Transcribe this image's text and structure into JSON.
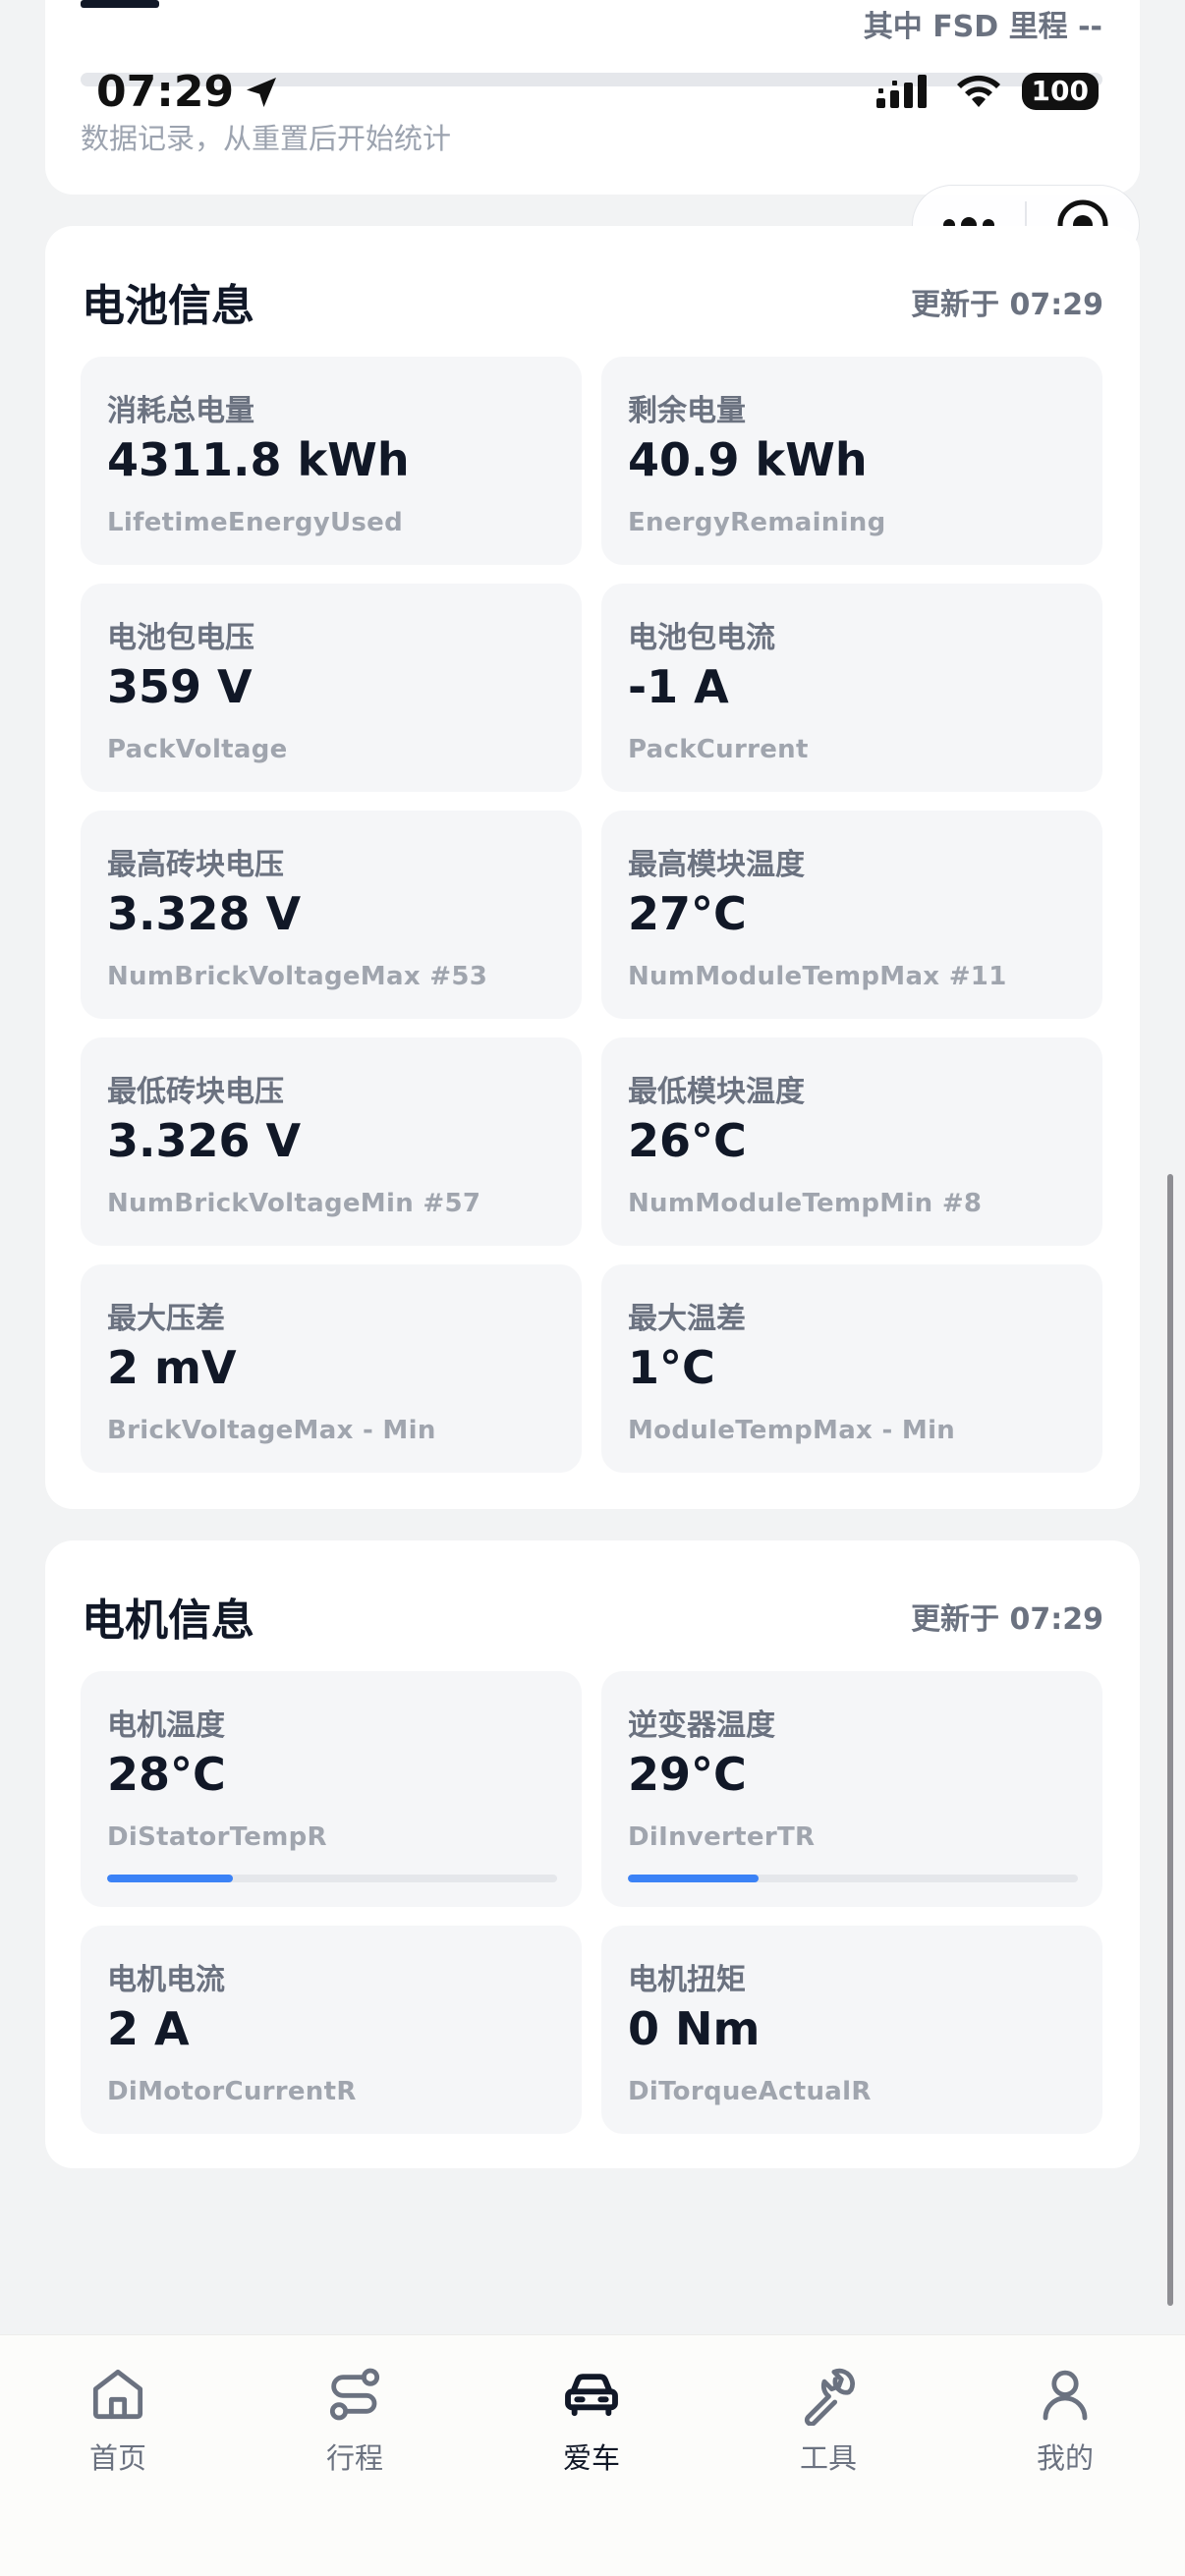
{
  "status_bar": {
    "time": "07:29",
    "battery": "100"
  },
  "top_card": {
    "fsd_label": "其中 FSD 里程 --",
    "note": "数据记录，从重置后开始统计"
  },
  "battery_section": {
    "title": "电池信息",
    "updated": "更新于 07:29",
    "tiles": [
      {
        "label": "消耗总电量",
        "value": "4311.8 kWh",
        "sub": "LifetimeEnergyUsed"
      },
      {
        "label": "剩余电量",
        "value": "40.9 kWh",
        "sub": "EnergyRemaining"
      },
      {
        "label": "电池包电压",
        "value": "359 V",
        "sub": "PackVoltage"
      },
      {
        "label": "电池包电流",
        "value": "-1 A",
        "sub": "PackCurrent"
      },
      {
        "label": "最高砖块电压",
        "value": "3.328 V",
        "sub": "NumBrickVoltageMax #53"
      },
      {
        "label": "最高模块温度",
        "value": "27°C",
        "sub": "NumModuleTempMax #11"
      },
      {
        "label": "最低砖块电压",
        "value": "3.326 V",
        "sub": "NumBrickVoltageMin #57"
      },
      {
        "label": "最低模块温度",
        "value": "26°C",
        "sub": "NumModuleTempMin #8"
      },
      {
        "label": "最大压差",
        "value": "2 mV",
        "sub": "BrickVoltageMax - Min"
      },
      {
        "label": "最大温差",
        "value": "1°C",
        "sub": "ModuleTempMax - Min"
      }
    ]
  },
  "motor_section": {
    "title": "电机信息",
    "updated": "更新于 07:29",
    "tiles": [
      {
        "label": "电机温度",
        "value": "28°C",
        "sub": "DiStatorTempR",
        "level_fraction": 0.28
      },
      {
        "label": "逆变器温度",
        "value": "29°C",
        "sub": "DiInverterTR",
        "level_fraction": 0.29
      },
      {
        "label": "电机电流",
        "value": "2 A",
        "sub": "DiMotorCurrentR"
      },
      {
        "label": "电机扭矩",
        "value": "0 Nm",
        "sub": "DiTorqueActualR"
      }
    ]
  },
  "tabbar": {
    "items": [
      {
        "label": "首页",
        "icon": "home-icon"
      },
      {
        "label": "行程",
        "icon": "route-icon"
      },
      {
        "label": "爱车",
        "icon": "car-icon"
      },
      {
        "label": "工具",
        "icon": "wrench-icon"
      },
      {
        "label": "我的",
        "icon": "user-icon"
      }
    ],
    "active_index": 2
  },
  "colors": {
    "accent": "#3b82f6",
    "page_bg": "#f2f3f4",
    "tile_bg": "#f5f6f8"
  }
}
